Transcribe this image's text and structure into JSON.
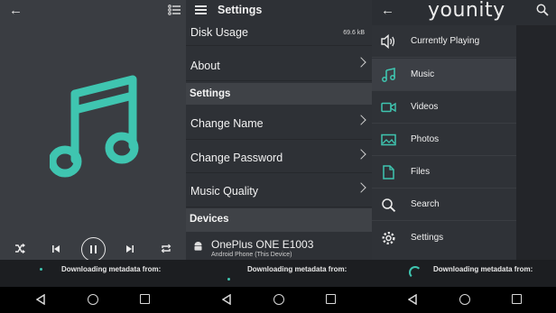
{
  "accent_color": "#3fc5b0",
  "player": {
    "back_icon": "arrow-left-icon",
    "queue_icon": "queue-list-icon",
    "art_icon": "music-note-icon",
    "controls": [
      "shuffle-icon",
      "previous-icon",
      "pause-icon",
      "next-icon",
      "repeat-icon"
    ]
  },
  "settings": {
    "title": "Settings",
    "rows": {
      "disk_usage_label": "Disk Usage",
      "disk_usage_value": "69.6 kB",
      "about_label": "About",
      "settings_header": "Settings",
      "change_name_label": "Change Name",
      "change_password_label": "Change Password",
      "music_quality_label": "Music Quality",
      "devices_header": "Devices"
    },
    "device": {
      "name": "OnePlus ONE E1003",
      "subtitle": "Android Phone (This Device)"
    }
  },
  "drawer": {
    "logo": "younity",
    "items": [
      {
        "label": "Currently Playing",
        "icon": "speaker-icon"
      },
      {
        "label": "Music",
        "icon": "music-note-icon"
      },
      {
        "label": "Videos",
        "icon": "video-camera-icon"
      },
      {
        "label": "Photos",
        "icon": "photo-icon"
      },
      {
        "label": "Files",
        "icon": "file-icon"
      },
      {
        "label": "Search",
        "icon": "search-icon"
      },
      {
        "label": "Settings",
        "icon": "gear-icon"
      }
    ]
  },
  "download_status": "Downloading metadata from:",
  "navbar": [
    "back-triangle-icon",
    "home-circle-icon",
    "recents-square-icon"
  ]
}
